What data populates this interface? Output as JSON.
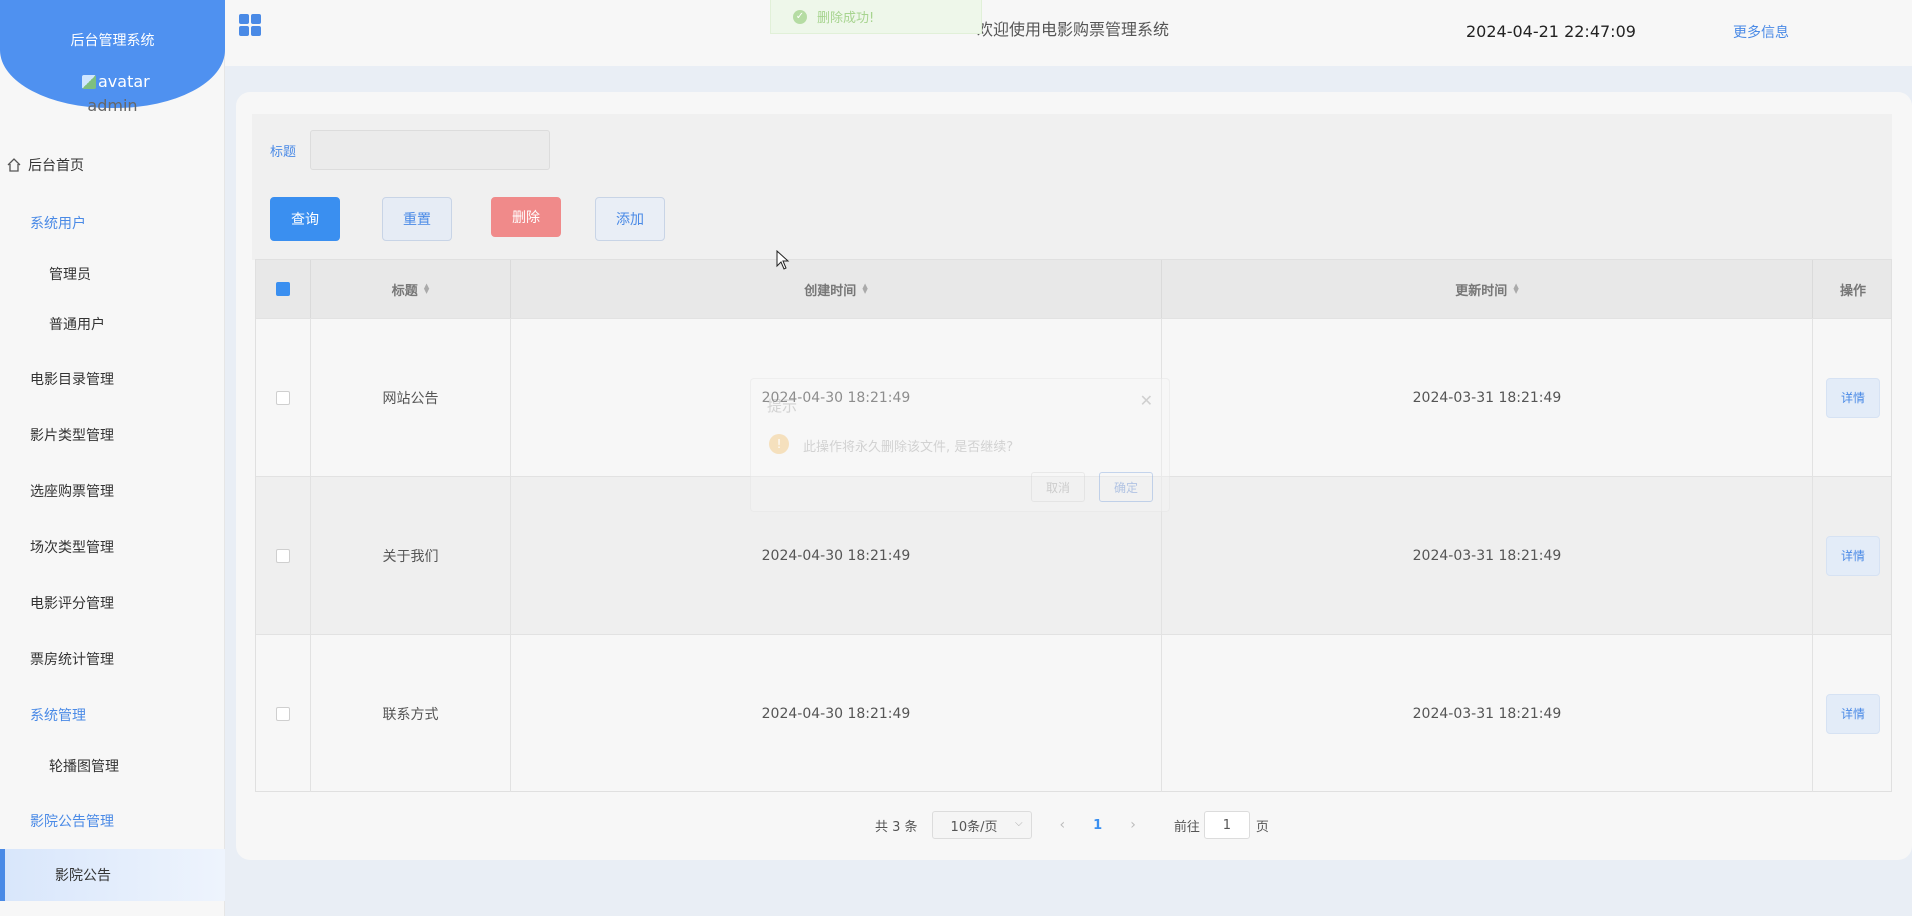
{
  "sidebar": {
    "brand_title": "后台管理系统",
    "avatar_alt": "avatar",
    "username": "admin",
    "items": [
      {
        "label": "后台首页"
      },
      {
        "label": "系统用户"
      },
      {
        "label": "管理员"
      },
      {
        "label": "普通用户"
      },
      {
        "label": "电影目录管理"
      },
      {
        "label": "影片类型管理"
      },
      {
        "label": "选座购票管理"
      },
      {
        "label": "场次类型管理"
      },
      {
        "label": "电影评分管理"
      },
      {
        "label": "票房统计管理"
      },
      {
        "label": "系统管理"
      },
      {
        "label": "轮播图管理"
      },
      {
        "label": "影院公告管理"
      },
      {
        "label": "影院公告"
      }
    ]
  },
  "header": {
    "title": "欢迎使用电影购票管理系统",
    "datetime": "2024-04-21 22:47:09",
    "more": "更多信息"
  },
  "toast": {
    "message": "删除成功!"
  },
  "search": {
    "label": "标题",
    "value": "",
    "query": "查询",
    "reset": "重置",
    "delete": "删除",
    "add": "添加"
  },
  "table": {
    "headers": [
      "标题",
      "创建时间",
      "更新时间",
      "操作"
    ],
    "rows": [
      {
        "title": "网站公告",
        "created": "2024-04-30 18:21:49",
        "updated": "2024-03-31 18:21:49",
        "action": "详情"
      },
      {
        "title": "关于我们",
        "created": "2024-04-30 18:21:49",
        "updated": "2024-03-31 18:21:49",
        "action": "详情"
      },
      {
        "title": "联系方式",
        "created": "2024-04-30 18:21:49",
        "updated": "2024-03-31 18:21:49",
        "action": "详情"
      }
    ]
  },
  "pagination": {
    "total": "共 3 条",
    "page_size": "10条/页",
    "current": "1",
    "goto_prefix": "前往",
    "goto_value": "1",
    "goto_suffix": "页"
  },
  "dialog": {
    "title": "提示",
    "message": "此操作将永久删除该文件, 是否继续?",
    "cancel": "取消",
    "confirm": "确定"
  }
}
